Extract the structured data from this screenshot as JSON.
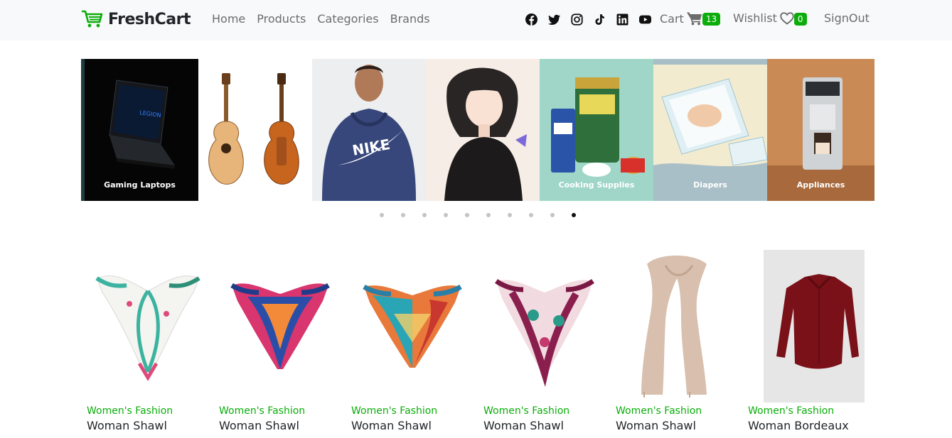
{
  "brand": {
    "name": "FreshCart",
    "icon": "cart-logo-icon",
    "color": "#0aad0a"
  },
  "nav": {
    "links": [
      "Home",
      "Products",
      "Categories",
      "Brands"
    ],
    "socials": [
      "facebook-icon",
      "twitter-icon",
      "instagram-icon",
      "tiktok-icon",
      "linkedin-icon",
      "youtube-icon"
    ],
    "cart_label": "Cart",
    "cart_count": "13",
    "wishlist_label": "Wishlist",
    "wishlist_count": "0",
    "signout_label": "SignOut"
  },
  "slider": {
    "slides": [
      {
        "caption": "Gaming Laptops",
        "subject": "laptop"
      },
      {
        "caption": "",
        "subject": "guitars"
      },
      {
        "caption": "",
        "subject": "hoodie"
      },
      {
        "caption": "",
        "subject": "anime-art"
      },
      {
        "caption": "Cooking Supplies",
        "subject": "groceries"
      },
      {
        "caption": "Diapers",
        "subject": "diapers"
      },
      {
        "caption": "Appliances",
        "subject": "coffee-machine"
      }
    ],
    "dot_count": 10,
    "active_dot": 9
  },
  "products": [
    {
      "category": "Women's Fashion",
      "title": "Woman Shawl",
      "image": "white-floral-scarf"
    },
    {
      "category": "Women's Fashion",
      "title": "Woman Shawl",
      "image": "magenta-blue-scarf"
    },
    {
      "category": "Women's Fashion",
      "title": "Woman Shawl",
      "image": "orange-teal-scarf"
    },
    {
      "category": "Women's Fashion",
      "title": "Woman Shawl",
      "image": "purple-floral-scarf"
    },
    {
      "category": "Women's Fashion",
      "title": "Woman Shawl",
      "image": "beige-long-scarf"
    },
    {
      "category": "Women's Fashion",
      "title": "Woman Bordeaux",
      "image": "bordeaux-blouse"
    }
  ],
  "colors": {
    "accent": "#0aad0a",
    "navbar_bg": "#f8f9fa",
    "text_muted": "#6c6c6c"
  }
}
